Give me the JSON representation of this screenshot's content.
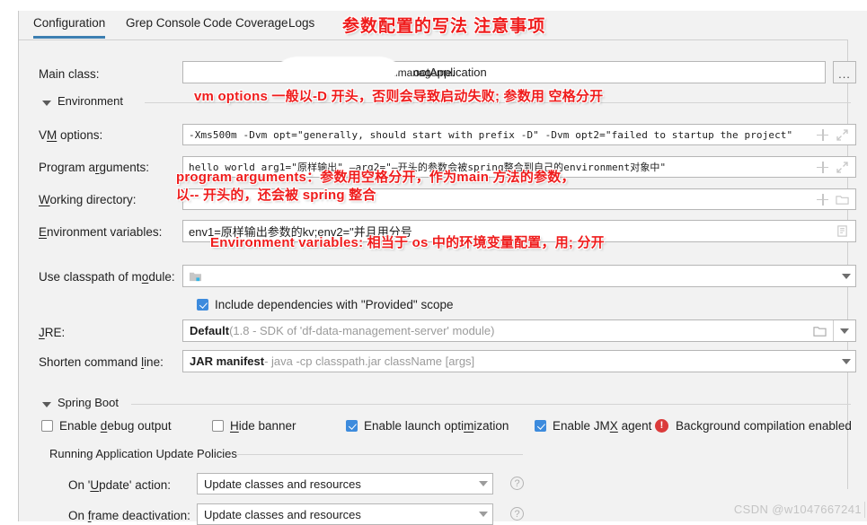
{
  "tabs": [
    {
      "label": "Configuration",
      "active": true
    },
    {
      "label": "Grep Console",
      "active": false
    },
    {
      "label": "Code Coverage",
      "active": false
    },
    {
      "label": "Logs",
      "active": false
    }
  ],
  "annotations": {
    "title": "参数配置的写法 注意事项",
    "vm_options": "vm options 一般以-D 开头，否则会导致启动失败; 参数用 空格分开",
    "program_arguments_line1": "program arguments：参数用空格分开，作为main 方法的参数，",
    "program_arguments_line2": "以-- 开头的，还会被 spring 整合",
    "environment_variables": "Environment variables: 相当于 os 中的环境变量配置，用; 分开"
  },
  "fields": {
    "main_class": {
      "label": "Main class:",
      "value": "...data-management....ootApplication",
      "value_visible_left": "",
      "value_visible_mid": "...taimanageme.",
      "value_visible_right": "ootApplication",
      "browse_label": "..."
    },
    "environment_section": "Environment",
    "vm_options": {
      "label_pre": "V",
      "label_mn": "M",
      "label_post": " options:",
      "value": "-Xms500m -Dvm opt=\"generally, should start with prefix -D\" -Dvm opt2=\"failed to startup the project\""
    },
    "program_arguments": {
      "label_pre": "Program a",
      "label_mn": "r",
      "label_post": "guments:",
      "value": "hello world arg1=\"原样输出\" —arg2=\"—开头的参数会被spring整合到自己的environment对象中\""
    },
    "working_directory": {
      "label_mn": "W",
      "label_post": "orking directory:",
      "value": ""
    },
    "environment_variables": {
      "label_mn": "E",
      "label_post": "nvironment variables:",
      "value": "env1=原样输出参数的kv;env2=\"并且用分号"
    },
    "use_classpath_of_module": {
      "label_pre": "Use classpath of m",
      "label_mn": "o",
      "label_post": "dule:",
      "value": ""
    },
    "include_dependencies": {
      "label": "Include dependencies with \"Provided\" scope",
      "checked": true
    },
    "jre": {
      "label_mn": "J",
      "label_post": "RE:",
      "value_bold": "Default",
      "value_hint": " (1.8 - SDK of 'df-data-management-server' module)"
    },
    "shorten_command_line": {
      "label_pre": "Shorten command ",
      "label_mn": "l",
      "label_post": "ine:",
      "value_bold": "JAR manifest",
      "value_hint": " - java -cp classpath.jar className [args]"
    }
  },
  "spring_boot": {
    "section_label": "Spring Boot",
    "checkboxes": [
      {
        "label_pre": "Enable ",
        "label_mn": "d",
        "label_post": "ebug output",
        "checked": false
      },
      {
        "label_pre": "",
        "label_mn": "H",
        "label_post": "ide banner",
        "checked": false
      },
      {
        "label_pre": "Enable launch opti",
        "label_mn": "m",
        "label_post": "ization",
        "checked": true
      },
      {
        "label_pre": "Enable JM",
        "label_mn": "X",
        "label_post": " agent",
        "checked": true
      }
    ],
    "background_compilation": {
      "badge": "!",
      "label": "Background compilation enabled"
    },
    "update_policies": {
      "section_label": "Running Application Update Policies",
      "rows": [
        {
          "label_pre": "On '",
          "label_mn": "U",
          "label_post": "pdate' action:",
          "value": "Update classes and resources",
          "help": "?"
        },
        {
          "label_pre": "On ",
          "label_mn": "f",
          "label_post": "rame deactivation:",
          "value": "Update classes and resources",
          "help": "?"
        }
      ]
    }
  },
  "watermark": "CSDN @w1047667241",
  "colors": {
    "accent": "#3c7fb1",
    "annotation_red": "#ef1c1c",
    "checkbox_blue": "#3d8bdd",
    "error_red": "#db3b3b",
    "panel_bg": "#f2f2f2"
  }
}
